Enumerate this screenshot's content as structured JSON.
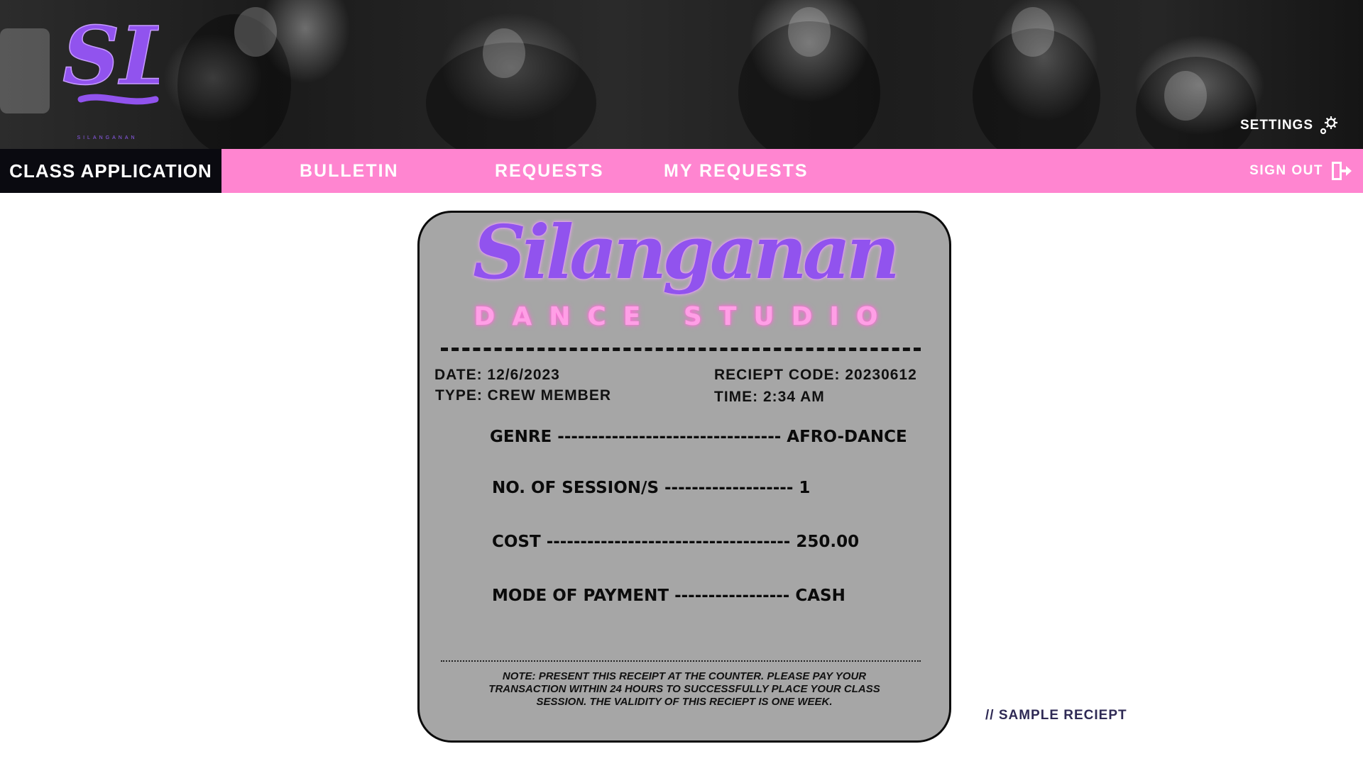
{
  "header": {
    "logo_text": "SL",
    "logo_caption": "SILANGANAN",
    "settings_label": "SETTINGS"
  },
  "nav": {
    "active_tab": "CLASS APPLICATION",
    "tabs": [
      {
        "label": "BULLETIN"
      },
      {
        "label": "REQUESTS"
      },
      {
        "label": "MY REQUESTS"
      }
    ],
    "sign_out_label": "SIGN OUT"
  },
  "receipt": {
    "brand_name": "Silanganan",
    "brand_sub": "DANCE STUDIO",
    "date": "DATE: 12/6/2023",
    "type": "TYPE: CREW MEMBER",
    "code": "RECIEPT CODE: 20230612",
    "time": "TIME: 2:34 AM",
    "rows": [
      {
        "text": "GENRE --------------------------------- AFRO-DANCE"
      },
      {
        "text": "NO. OF SESSION/S ------------------- 1"
      },
      {
        "text": "COST ------------------------------------ 250.00"
      },
      {
        "text": "MODE OF PAYMENT ----------------- CASH"
      }
    ],
    "note": "NOTE: PRESENT THIS RECEIPT AT THE COUNTER. PLEASE PAY YOUR TRANSACTION WITHIN 24 HOURS TO SUCCESSFULLY PLACE YOUR CLASS SESSION. THE VALIDITY OF THIS RECIEPT IS ONE WEEK."
  },
  "caption": "// SAMPLE RECIEPT",
  "colors": {
    "accent_pink": "#ff85d0",
    "brand_purple": "#9153ee",
    "nav_active_bg": "#0a0a10"
  }
}
